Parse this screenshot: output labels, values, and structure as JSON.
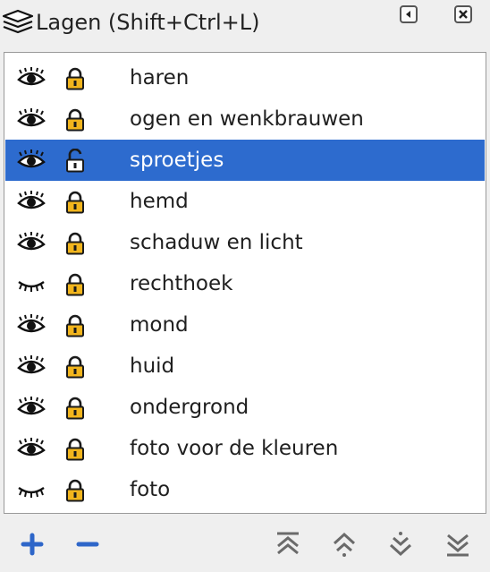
{
  "panel": {
    "title": "Lagen (Shift+Ctrl+L)",
    "icon": "layers-icon",
    "window_buttons": [
      "collapse-icon",
      "close-icon"
    ]
  },
  "layers": [
    {
      "name": "haren",
      "visible": true,
      "locked": true,
      "selected": false
    },
    {
      "name": "ogen en wenkbrauwen",
      "visible": true,
      "locked": true,
      "selected": false
    },
    {
      "name": "sproetjes",
      "visible": true,
      "locked": false,
      "selected": true
    },
    {
      "name": "hemd",
      "visible": true,
      "locked": true,
      "selected": false
    },
    {
      "name": "schaduw en licht",
      "visible": true,
      "locked": true,
      "selected": false
    },
    {
      "name": "rechthoek",
      "visible": false,
      "locked": true,
      "selected": false
    },
    {
      "name": "mond",
      "visible": true,
      "locked": true,
      "selected": false
    },
    {
      "name": "huid",
      "visible": true,
      "locked": true,
      "selected": false
    },
    {
      "name": "ondergrond",
      "visible": true,
      "locked": true,
      "selected": false
    },
    {
      "name": "foto voor de kleuren",
      "visible": true,
      "locked": true,
      "selected": false
    },
    {
      "name": "foto",
      "visible": false,
      "locked": true,
      "selected": false
    }
  ],
  "toolbar": {
    "buttons": [
      "add-layer-icon",
      "remove-layer-icon",
      "raise-to-top-icon",
      "raise-layer-icon",
      "lower-layer-icon",
      "lower-to-bottom-icon"
    ]
  },
  "colors": {
    "selection": "#2d6bce",
    "lock_gold": "#f2b51d",
    "toolbar_blue": "#2e66c9",
    "toolbar_gray": "#6a6a6a"
  }
}
